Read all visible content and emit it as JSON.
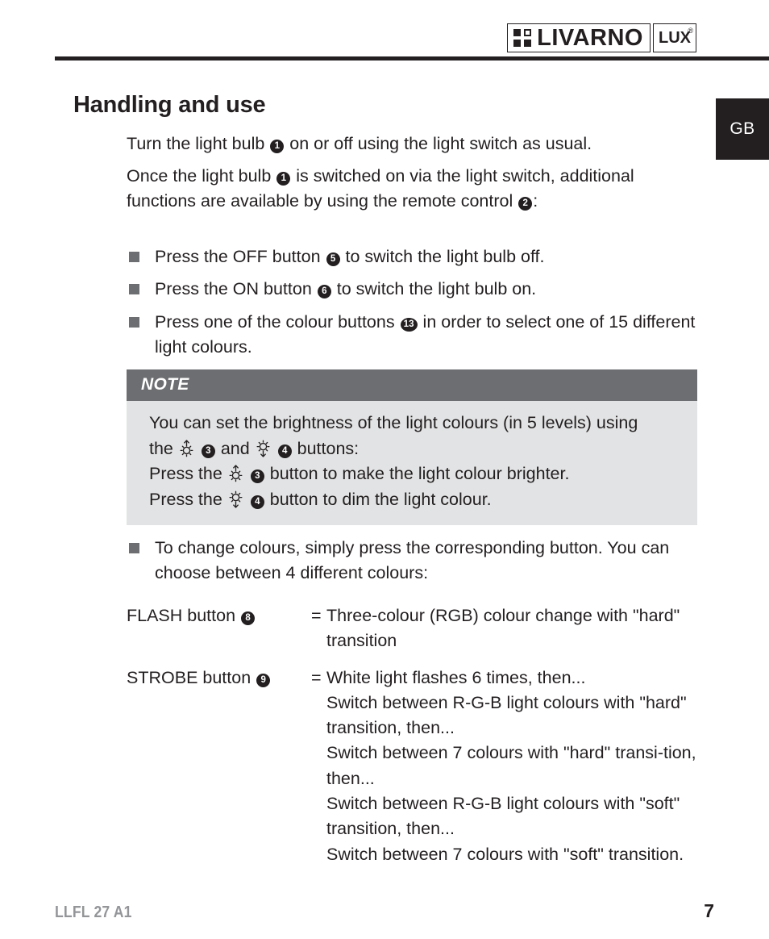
{
  "header": {
    "logo_brand": "LIVARNO",
    "logo_sub": "LUX",
    "logo_registered": "®",
    "logo_glyph_icon": "window-pane-icon"
  },
  "language_tab": {
    "label": "GB"
  },
  "main": {
    "heading": "Handling and use",
    "paragraphs": [
      {
        "id": "para-1",
        "parts": [
          {
            "type": "text",
            "value": "Turn the light bulb "
          },
          {
            "type": "marker",
            "value": "1"
          },
          {
            "type": "text",
            "value": " on or off using the light switch as usual."
          }
        ]
      },
      {
        "id": "para-2",
        "parts": [
          {
            "type": "text",
            "value": "Once the light bulb "
          },
          {
            "type": "marker",
            "value": "1"
          },
          {
            "type": "text",
            "value": " is switched on via the light switch, additional functions are available by using the remote control "
          },
          {
            "type": "marker",
            "value": "2"
          },
          {
            "type": "text",
            "value": ":"
          }
        ]
      }
    ],
    "bullets": [
      {
        "parts": [
          {
            "type": "text",
            "value": "Press the OFF button "
          },
          {
            "type": "marker",
            "value": "5"
          },
          {
            "type": "text",
            "value": " to switch the light bulb off."
          }
        ]
      },
      {
        "parts": [
          {
            "type": "text",
            "value": "Press the ON button "
          },
          {
            "type": "marker",
            "value": "6"
          },
          {
            "type": "text",
            "value": " to switch the light bulb on."
          }
        ]
      },
      {
        "parts": [
          {
            "type": "text",
            "value": "Press one of the colour buttons "
          },
          {
            "type": "marker",
            "value": "13",
            "wide": true
          },
          {
            "type": "text",
            "value": " in order to select one of 15 different light colours."
          }
        ]
      }
    ],
    "note": {
      "header_label": "NOTE",
      "lines": [
        {
          "parts": [
            {
              "type": "text",
              "value": "You can set the brightness of the light colours (in 5 levels) using"
            }
          ]
        },
        {
          "parts": [
            {
              "type": "text",
              "value": "the "
            },
            {
              "type": "icon",
              "value": "brightness-up-icon"
            },
            {
              "type": "text",
              "value": " "
            },
            {
              "type": "marker",
              "value": "3"
            },
            {
              "type": "text",
              "value": " and "
            },
            {
              "type": "icon",
              "value": "brightness-down-icon"
            },
            {
              "type": "text",
              "value": " "
            },
            {
              "type": "marker",
              "value": "4"
            },
            {
              "type": "text",
              "value": " buttons:"
            }
          ]
        },
        {
          "parts": [
            {
              "type": "text",
              "value": "Press the "
            },
            {
              "type": "icon",
              "value": "brightness-up-icon"
            },
            {
              "type": "text",
              "value": " "
            },
            {
              "type": "marker",
              "value": "3"
            },
            {
              "type": "text",
              "value": " button to make the light colour brighter."
            }
          ]
        },
        {
          "parts": [
            {
              "type": "text",
              "value": "Press the "
            },
            {
              "type": "icon",
              "value": "brightness-down-icon"
            },
            {
              "type": "text",
              "value": " "
            },
            {
              "type": "marker",
              "value": "4"
            },
            {
              "type": "text",
              "value": " button to dim the light colour."
            }
          ]
        }
      ]
    },
    "bullets_2": [
      {
        "parts": [
          {
            "type": "text",
            "value": "To change colours, simply press the corresponding button. You can choose between 4 different colours:"
          }
        ]
      }
    ],
    "definitions": [
      {
        "term_parts": [
          {
            "type": "text",
            "value": "FLASH button "
          },
          {
            "type": "marker",
            "value": "8"
          }
        ],
        "equals": "=",
        "description": "Three-colour (RGB) colour change with \"hard\" transition"
      },
      {
        "term_parts": [
          {
            "type": "text",
            "value": "STROBE button "
          },
          {
            "type": "marker",
            "value": "9"
          }
        ],
        "equals": "=",
        "description": "White light flashes 6 times, then...\nSwitch between R-G-B light colours with \"hard\" transition, then...\nSwitch between 7 colours with \"hard\" transi-tion, then...\nSwitch between R-G-B light colours with \"soft\" transition, then...\nSwitch between 7 colours with \"soft\" transition."
      }
    ]
  },
  "footer": {
    "model": "LLFL 27 A1",
    "page_number": "7"
  },
  "colors": {
    "ink": "#231f20",
    "note_header_bg": "#6d6e71",
    "note_body_bg": "#e2e3e4",
    "bullet_gray": "#6d6e71",
    "footer_gray": "#939598"
  }
}
